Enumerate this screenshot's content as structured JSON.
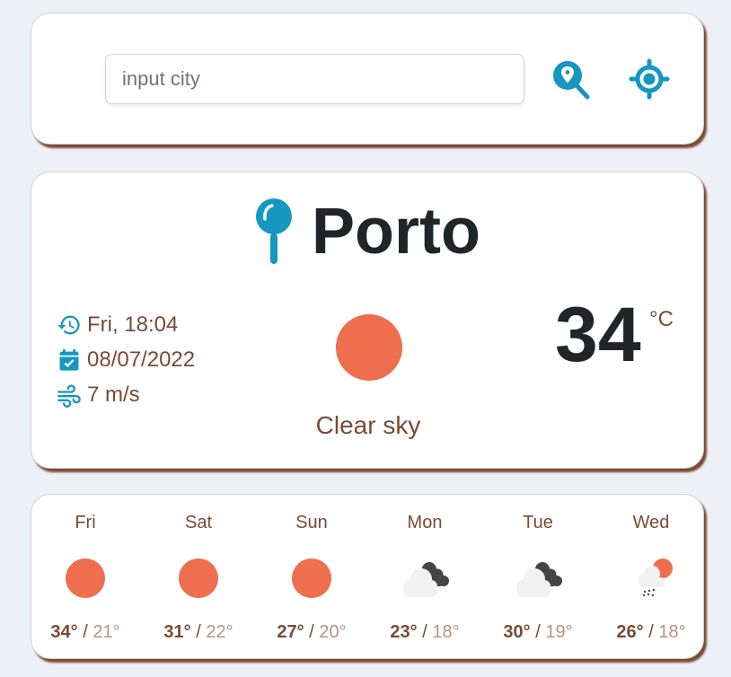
{
  "search": {
    "placeholder": "input city",
    "value": "",
    "search_button": "search-location",
    "locate_button": "current-location"
  },
  "colors": {
    "accent": "#1597bf",
    "text_brown": "#7a4a35",
    "sun": "#ee6e4e",
    "dark": "#212529",
    "background": "#eef0f8"
  },
  "current": {
    "city": "Porto",
    "day_time": "Fri, 18:04",
    "date": "08/07/2022",
    "wind": "7 m/s",
    "temperature": "34",
    "unit": "°C",
    "description": "Clear sky",
    "icon": "sun-icon"
  },
  "forecast": [
    {
      "day": "Fri",
      "max": "34°",
      "min": "21°",
      "icon": "sun-icon"
    },
    {
      "day": "Sat",
      "max": "31°",
      "min": "22°",
      "icon": "sun-icon"
    },
    {
      "day": "Sun",
      "max": "27°",
      "min": "20°",
      "icon": "sun-icon"
    },
    {
      "day": "Mon",
      "max": "23°",
      "min": "18°",
      "icon": "broken-clouds-icon"
    },
    {
      "day": "Tue",
      "max": "30°",
      "min": "19°",
      "icon": "broken-clouds-icon"
    },
    {
      "day": "Wed",
      "max": "26°",
      "min": "18°",
      "icon": "rain-sun-icon"
    }
  ],
  "separator": "/"
}
